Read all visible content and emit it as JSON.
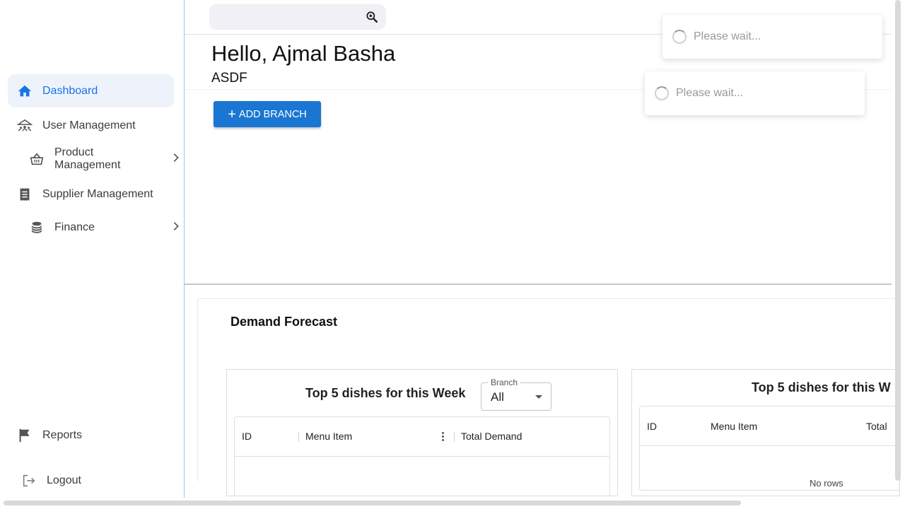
{
  "search": {
    "placeholder": ""
  },
  "sidebar": {
    "items": [
      {
        "label": "Dashboard",
        "icon": "home-icon",
        "active": true
      },
      {
        "label": "User Management",
        "icon": "users-icon"
      },
      {
        "label": "Product Management",
        "icon": "basket-icon",
        "expandable": true
      },
      {
        "label": "Supplier Management",
        "icon": "receipt-icon"
      },
      {
        "label": "Finance",
        "icon": "coins-icon",
        "expandable": true
      },
      {
        "label": "Reports",
        "icon": "flag-icon"
      },
      {
        "label": "Logout",
        "icon": "logout-icon"
      }
    ]
  },
  "header": {
    "greeting": "Hello, Ajmal Basha",
    "org": "ASDF"
  },
  "actions": {
    "add_branch": "ADD BRANCH"
  },
  "forecast": {
    "title": "Demand Forecast",
    "week_card": {
      "title": "Top 5 dishes for this Week",
      "branch_label": "Branch",
      "branch_value": "All",
      "columns": [
        "ID",
        "Menu Item",
        "Total Demand"
      ]
    },
    "second_card": {
      "title": "Top 5 dishes for this W",
      "columns": [
        "ID",
        "Menu Item",
        "Total"
      ],
      "empty": "No rows"
    }
  },
  "toasts": [
    "Please wait...",
    "Please wait..."
  ],
  "colors": {
    "accent": "#1976d2",
    "active_nav": "#1a73e8",
    "active_bg": "#eef3fb"
  }
}
